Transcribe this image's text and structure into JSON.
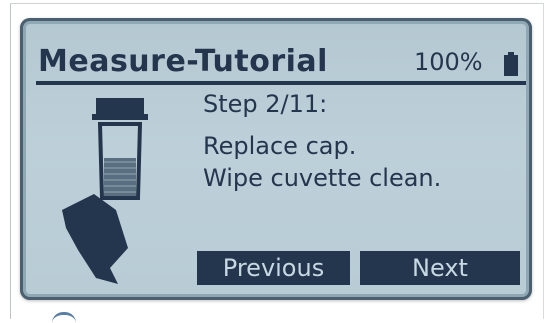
{
  "header": {
    "title": "Measure-Tutorial",
    "battery_percent_label": "100%",
    "battery_icon": "battery-full-icon"
  },
  "content": {
    "step_label": "Step 2/11:",
    "instruction_line_1": "Replace cap.",
    "instruction_line_2": "Wipe cuvette clean.",
    "illustration_icon": "cuvette-and-wipe-icon"
  },
  "buttons": {
    "previous_label": "Previous",
    "next_label": "Next"
  },
  "colors": {
    "lcd_background": "#bccfd9",
    "lcd_foreground": "#24364e"
  }
}
